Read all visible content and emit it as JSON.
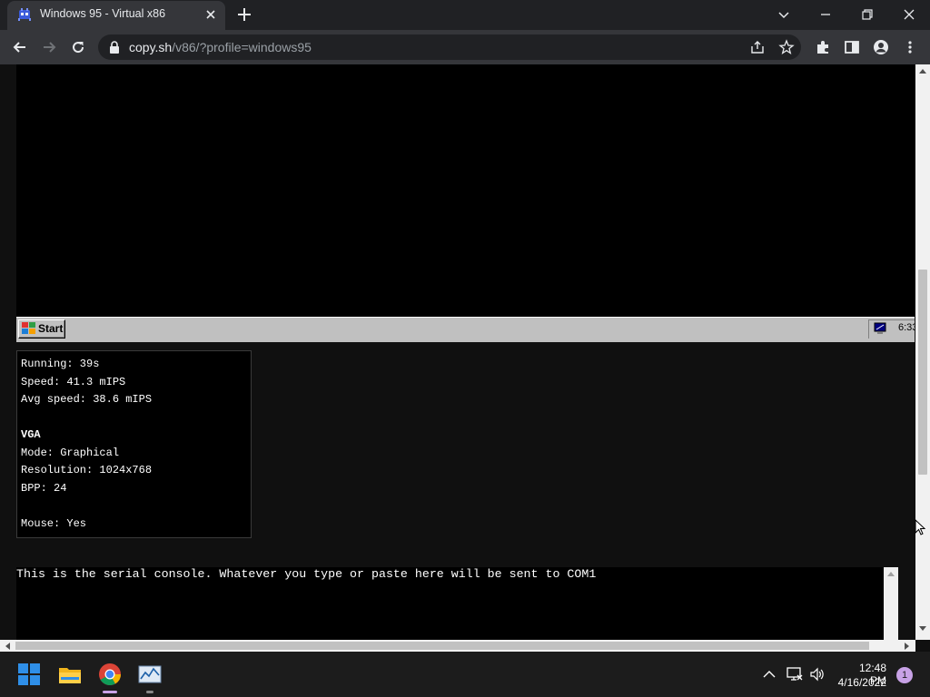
{
  "browser": {
    "tab_title": "Windows 95 - Virtual x86",
    "url_host": "copy.sh",
    "url_path": "/v86/?profile=windows95"
  },
  "vm": {
    "start_label": "Start",
    "clock": "6:33"
  },
  "stats": {
    "running": "Running: 39s",
    "speed": "Speed: 41.3 mIPS",
    "avg_speed": "Avg speed: 38.6 mIPS",
    "vga_heading": "VGA",
    "mode": "Mode: Graphical",
    "resolution": "Resolution: 1024x768",
    "bpp": "BPP: 24",
    "mouse": "Mouse: Yes"
  },
  "serial": {
    "text": "This is the serial console. Whatever you type or paste here will be sent to COM1"
  },
  "os_taskbar": {
    "time": "12:48 PM",
    "date": "4/16/2022",
    "notification_count": "1"
  },
  "colors": {
    "chrome_dark": "#202124",
    "chrome_toolbar": "#35363a",
    "win95_gray": "#c0c0c0",
    "win11_taskbar": "#1c1c1c",
    "win11_blue": "#0078d4"
  }
}
